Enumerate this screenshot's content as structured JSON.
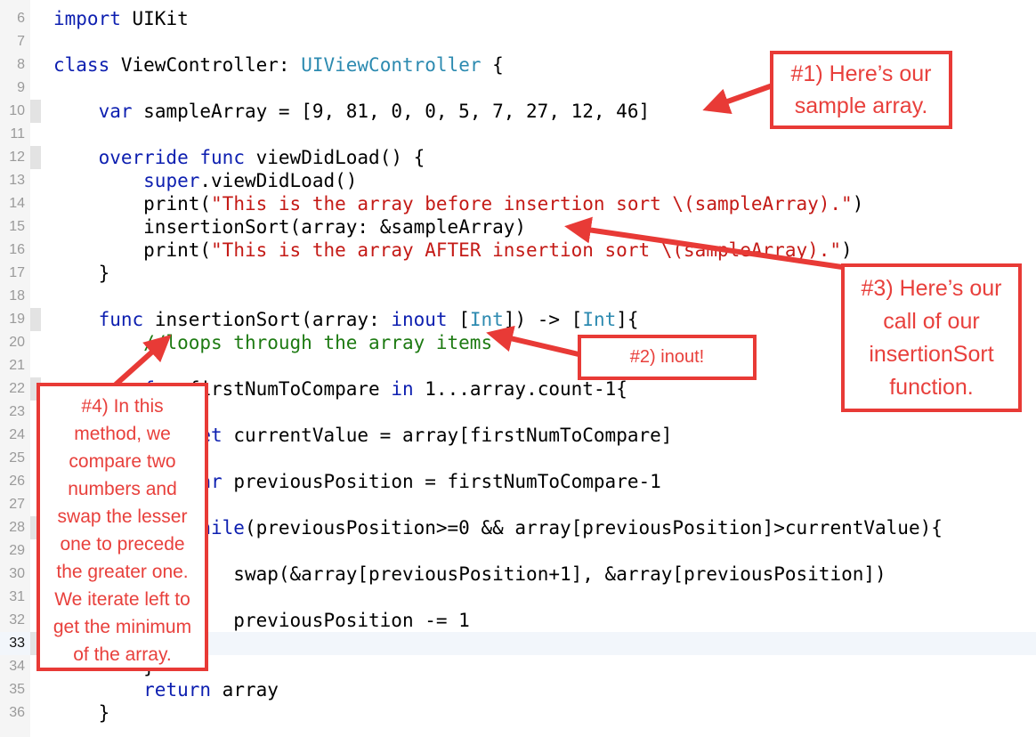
{
  "editor": {
    "lines": [
      {
        "number": "6",
        "code": "import UIKit"
      },
      {
        "number": "7",
        "code": ""
      },
      {
        "number": "8",
        "code": "class ViewController: UIViewController {"
      },
      {
        "number": "9",
        "code": ""
      },
      {
        "number": "10",
        "code": "    var sampleArray = [9, 81, 0, 0, 5, 7, 27, 12, 46]"
      },
      {
        "number": "11",
        "code": ""
      },
      {
        "number": "12",
        "code": "    override func viewDidLoad() {"
      },
      {
        "number": "13",
        "code": "        super.viewDidLoad()"
      },
      {
        "number": "14",
        "code": "        print(\"This is the array before insertion sort \\(sampleArray).\")"
      },
      {
        "number": "15",
        "code": "        insertionSort(array: &sampleArray)"
      },
      {
        "number": "16",
        "code": "        print(\"This is the array AFTER insertion sort \\(sampleArray).\")"
      },
      {
        "number": "17",
        "code": "    }"
      },
      {
        "number": "18",
        "code": ""
      },
      {
        "number": "19",
        "code": "    func insertionSort(array: inout [Int]) -> [Int]{"
      },
      {
        "number": "20",
        "code": "        //loops through the array items"
      },
      {
        "number": "21",
        "code": ""
      },
      {
        "number": "22",
        "code": "        for firstNumToCompare in 1...array.count-1{"
      },
      {
        "number": "23",
        "code": ""
      },
      {
        "number": "24",
        "code": "            let currentValue = array[firstNumToCompare]"
      },
      {
        "number": "25",
        "code": ""
      },
      {
        "number": "26",
        "code": "            var previousPosition = firstNumToCompare-1"
      },
      {
        "number": "27",
        "code": ""
      },
      {
        "number": "28",
        "code": "            while(previousPosition>=0 && array[previousPosition]>currentValue){"
      },
      {
        "number": "29",
        "code": ""
      },
      {
        "number": "30",
        "code": "                swap(&array[previousPosition+1], &array[previousPosition])"
      },
      {
        "number": "31",
        "code": ""
      },
      {
        "number": "32",
        "code": "                previousPosition -= 1"
      },
      {
        "number": "33",
        "code": "            }"
      },
      {
        "number": "34",
        "code": "        }"
      },
      {
        "number": "35",
        "code": "        return array"
      },
      {
        "number": "36",
        "code": "    }"
      }
    ],
    "current_line": "33",
    "keyword_color": "#0d1fb0",
    "type_color": "#2c8ab0",
    "string_color": "#c41a16",
    "comment_color": "#1d7a12"
  },
  "annotations": {
    "accent_color": "#e83a36",
    "callout_1": {
      "lines": [
        "#1) Here’s our",
        "sample array."
      ]
    },
    "callout_2": {
      "lines": [
        "#2) inout!"
      ]
    },
    "callout_3": {
      "lines": [
        "#3) Here’s our",
        "call of our",
        "insertionSort",
        "function."
      ]
    },
    "callout_4": {
      "lines": [
        "#4) In this",
        "method, we",
        "compare two",
        "numbers and",
        "swap the lesser",
        "one to precede",
        "the greater one.",
        "We iterate left to",
        "get the minimum",
        "of the array."
      ]
    }
  }
}
